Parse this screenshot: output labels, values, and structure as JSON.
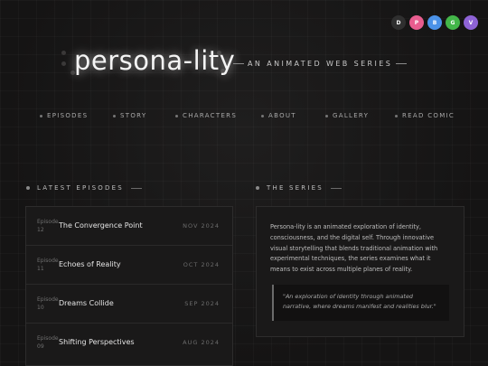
{
  "platforms": [
    {
      "label": "D",
      "color": "#2f2f2f",
      "icon": "d-platform-icon"
    },
    {
      "label": "P",
      "color": "#e85d8f",
      "icon": "p-platform-icon"
    },
    {
      "label": "B",
      "color": "#4b92e8",
      "icon": "b-platform-icon"
    },
    {
      "label": "G",
      "color": "#43b649",
      "icon": "g-platform-icon"
    },
    {
      "label": "V",
      "color": "#8e63d6",
      "icon": "v-platform-icon"
    }
  ],
  "hero": {
    "title": "persona-lity",
    "tagline": "AN ANIMATED WEB SERIES"
  },
  "nav": {
    "items": [
      {
        "label": "EPISODES"
      },
      {
        "label": "STORY"
      },
      {
        "label": "CHARACTERS"
      },
      {
        "label": "ABOUT"
      },
      {
        "label": "GALLERY"
      },
      {
        "label": "READ COMIC"
      }
    ]
  },
  "latest": {
    "heading": "LATEST EPISODES",
    "episodes": [
      {
        "label": "Episode",
        "number": "12",
        "title": "The Convergence Point",
        "date": "NOV 2024"
      },
      {
        "label": "Episode",
        "number": "11",
        "title": "Echoes of Reality",
        "date": "OCT 2024"
      },
      {
        "label": "Episode",
        "number": "10",
        "title": "Dreams Collide",
        "date": "SEP 2024"
      },
      {
        "label": "Episode",
        "number": "09",
        "title": "Shifting Perspectives",
        "date": "AUG 2024"
      }
    ]
  },
  "series": {
    "heading": "THE SERIES",
    "description": "Persona-lity is an animated exploration of identity, consciousness, and the digital self. Through innovative visual storytelling that blends traditional animation with experimental techniques, the series examines what it means to exist across multiple planes of reality.",
    "quote": "\"An exploration of identity through animated narrative, where dreams manifest and realities blur.\""
  }
}
